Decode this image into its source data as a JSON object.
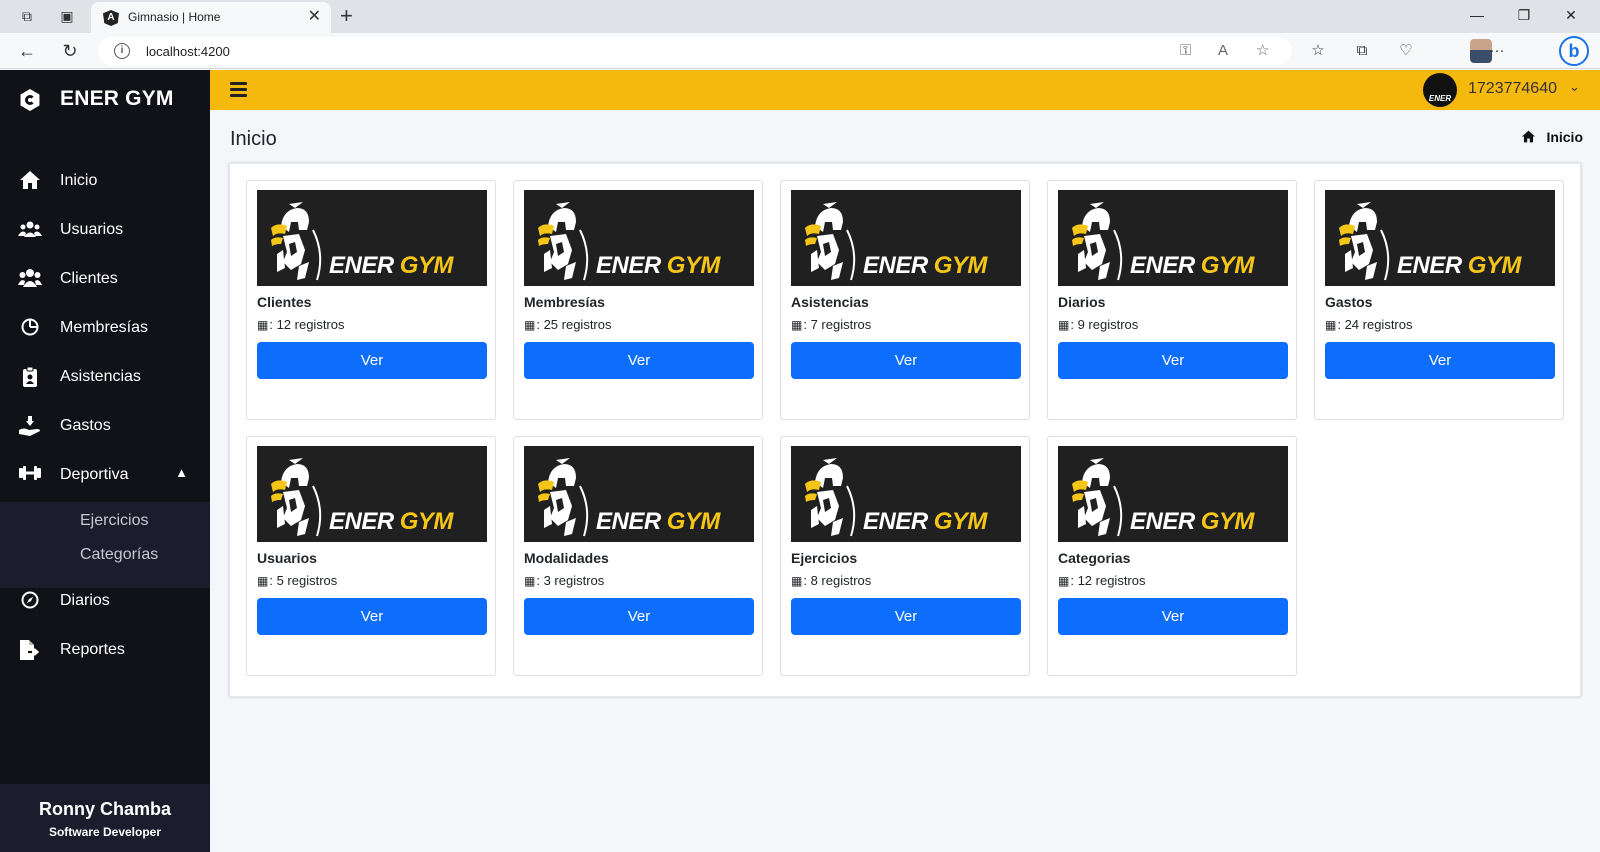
{
  "browser": {
    "tab_title": "Gimnasio | Home",
    "tab_favicon": "A",
    "url": "localhost:4200"
  },
  "sidebar": {
    "brand": "ENER GYM",
    "items": [
      {
        "label": "Inicio",
        "icon": "home-icon"
      },
      {
        "label": "Usuarios",
        "icon": "users-icon"
      },
      {
        "label": "Clientes",
        "icon": "clients-icon"
      },
      {
        "label": "Membresías",
        "icon": "chart-pie-icon"
      },
      {
        "label": "Asistencias",
        "icon": "clipboard-user-icon"
      },
      {
        "label": "Gastos",
        "icon": "hand-coin-icon"
      },
      {
        "label": "Deportiva",
        "icon": "dumbbell-icon"
      },
      {
        "label": "Diarios",
        "icon": "compass-icon"
      },
      {
        "label": "Reportes",
        "icon": "file-export-icon"
      }
    ],
    "submenu": [
      "Ejercicios",
      "Categorías"
    ],
    "footer": {
      "name": "Ronny Chamba",
      "role": "Software Developer"
    }
  },
  "header": {
    "user_id": "1723774640",
    "avatar_text": "ENER"
  },
  "page": {
    "title": "Inicio",
    "breadcrumb": "Inicio"
  },
  "logo": {
    "ener": "ENER",
    "gym": "GYM"
  },
  "cards": [
    {
      "title": "Clientes",
      "count": ": 12 registros",
      "button": "Ver"
    },
    {
      "title": "Membresías",
      "count": ": 25 registros",
      "button": "Ver"
    },
    {
      "title": "Asistencias",
      "count": ": 7 registros",
      "button": "Ver"
    },
    {
      "title": "Diarios",
      "count": ": 9 registros",
      "button": "Ver"
    },
    {
      "title": "Gastos",
      "count": ": 24 registros",
      "button": "Ver"
    },
    {
      "title": "Usuarios",
      "count": ": 5 registros",
      "button": "Ver"
    },
    {
      "title": "Modalidades",
      "count": ": 3 registros",
      "button": "Ver"
    },
    {
      "title": "Ejercicios",
      "count": ": 8 registros",
      "button": "Ver"
    },
    {
      "title": "Categorias",
      "count": ": 12 registros",
      "button": "Ver"
    }
  ],
  "colors": {
    "sidebar_bg": "#111118",
    "appbar_bg": "#f5b80d",
    "button_bg": "#0d6efd",
    "logo_accent": "#f5c518"
  }
}
